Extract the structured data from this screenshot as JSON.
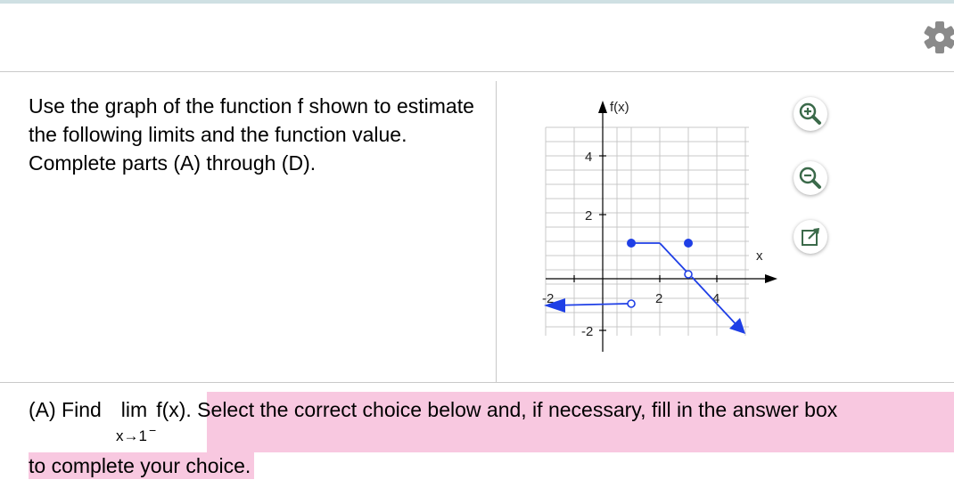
{
  "instructions": "Use the graph of the function f shown to estimate the following limits and the function value. Complete parts (A) through (D).",
  "graph": {
    "y_axis_label": "f(x)",
    "x_axis_label": "x",
    "x_ticks": [
      "-2",
      "2",
      "4"
    ],
    "y_ticks": [
      "4",
      "2",
      "-2"
    ],
    "colors": {
      "grid": "#c8c8c8",
      "axis": "#000000",
      "curve": "#1f3fe6"
    }
  },
  "toolbar": {
    "zoom_in_icon": "zoom-in-icon",
    "zoom_out_icon": "zoom-out-icon",
    "popout_icon": "popout-icon",
    "settings_icon": "gear-icon"
  },
  "question": {
    "part_prefix": "(A) Find",
    "lim_word": "lim",
    "function": "f(x)",
    "highlighted_text": ". Select the correct choice below and, if necessary, fill in the answer box",
    "subscript": "x→1",
    "subscript_sup": "−",
    "line2": "to complete your choice."
  },
  "colors": {
    "highlight": "#f8c8e0",
    "divider": "#c9c9c9"
  }
}
